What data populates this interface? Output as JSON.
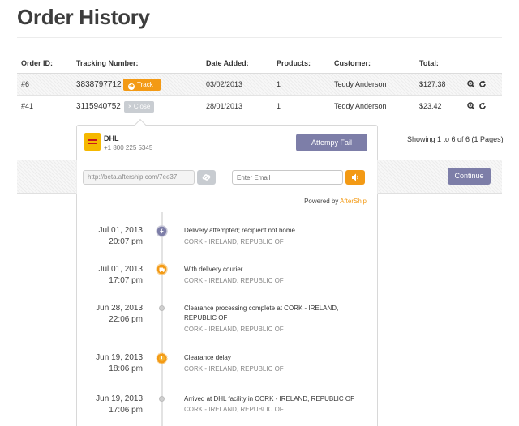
{
  "page": {
    "title": "Order History"
  },
  "table": {
    "headers": {
      "order_id": "Order ID:",
      "tracking": "Tracking Number:",
      "date": "Date Added:",
      "products": "Products:",
      "customer": "Customer:",
      "total": "Total:"
    },
    "rows": [
      {
        "order_id": "#6",
        "tracking": "3838797712",
        "action": "Track",
        "date": "03/02/2013",
        "products": "1",
        "customer": "Teddy Anderson",
        "total": "$127.38"
      },
      {
        "order_id": "#41",
        "tracking": "3115940752",
        "action": "× Close",
        "date": "28/01/2013",
        "products": "1",
        "customer": "Teddy Anderson",
        "total": "$23.42"
      }
    ]
  },
  "pagination": {
    "showing": "Showing 1 to 6 of 6 (1 Pages)"
  },
  "tracking_panel": {
    "carrier": {
      "name": "DHL",
      "phone": "+1 800 225 5345"
    },
    "status_button": "Attempy Fail",
    "share_url": "http://beta.aftership.com/7ee37",
    "email_placeholder": "Enter Email",
    "powered_by": {
      "prefix": "Powered by ",
      "brand": "AfterShip"
    },
    "events": [
      {
        "date": "Jul 01, 2013",
        "time": "20:07 pm",
        "description": "Delivery attempted; recipient not home",
        "location": "CORK - IRELAND, REPUBLIC OF",
        "icon": "lightning-icon",
        "color": "#7d7ea8"
      },
      {
        "date": "Jul 01, 2013",
        "time": "17:07 pm",
        "description": "With delivery courier",
        "location": "CORK - IRELAND, REPUBLIC OF",
        "icon": "courier-icon",
        "color": "#f39a15"
      },
      {
        "date": "Jun 28, 2013",
        "time": "22:06 pm",
        "description": "Clearance processing complete at CORK - IRELAND, REPUBLIC OF",
        "location": "CORK - IRELAND, REPUBLIC OF",
        "icon": "dot-icon",
        "color": "#cfcfcf"
      },
      {
        "date": "Jun 19, 2013",
        "time": "18:06 pm",
        "description": "Clearance delay",
        "location": "CORK - IRELAND, REPUBLIC OF",
        "icon": "alert-icon",
        "color": "#f39a15"
      },
      {
        "date": "Jun 19, 2013",
        "time": "17:06 pm",
        "description": "Arrived at DHL facility in CORK - IRELAND, REPUBLIC OF",
        "location": "CORK - IRELAND, REPUBLIC OF",
        "icon": "dot-icon",
        "color": "#cfcfcf"
      }
    ]
  },
  "continue_button": "Continue",
  "colors": {
    "accent_orange": "#f39a15",
    "accent_purple": "#7d7ea8",
    "title": "#3d3d3d"
  }
}
